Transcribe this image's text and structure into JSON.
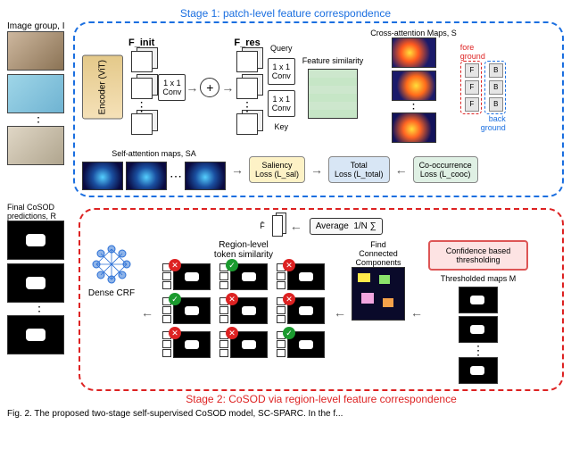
{
  "stage1": {
    "title": "Stage 1: patch-level feature correspondence",
    "image_group_label": "Image group, I",
    "encoder_label": "Encoder\n(ViT)",
    "F_init": "F_init",
    "F_res": "F_res",
    "conv_1x1": "1 x 1\nConv",
    "query_label": "Query",
    "key_label": "Key",
    "feature_sim_label": "Feature similarity",
    "cross_attn_label": "Cross-attention\nMaps, S",
    "fore_label": "fore\nground",
    "back_label": "back\nground",
    "F_letter": "F",
    "B_letter": "B",
    "self_attn_label": "Self-attention maps, SA",
    "loss_sal": "Saliency\nLoss (L_sal)",
    "loss_total": "Total\nLoss (L_total)",
    "loss_cooc": "Co-occurrence\nLoss (L_cooc)"
  },
  "stage2": {
    "title": "Stage 2: CoSOD via region-level feature correspondence",
    "final_preds_label": "Final CoSOD\npredictions, R",
    "dense_crf_label": "Dense CRF",
    "region_sim_label": "Region-level\ntoken similarity",
    "average_label": "Average",
    "average_formula": "1/N ∑",
    "Fbar_label": "F̄",
    "find_cc_label": "Find\nConnected\nComponents",
    "conf_thresh_label": "Confidence based\nthresholding",
    "thresh_maps_label": "Thresholded        maps M"
  },
  "caption": "Fig. 2.  The proposed two-stage self-supervised CoSOD model, SC-SPARC. In the f..."
}
